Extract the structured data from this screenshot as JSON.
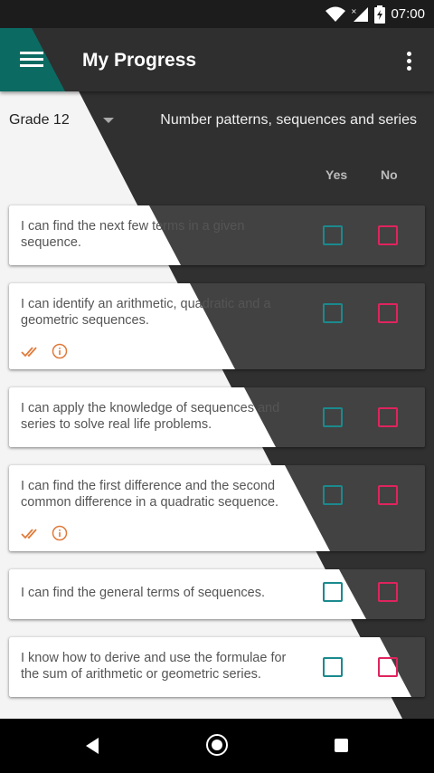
{
  "status": {
    "time": "07:00"
  },
  "app_bar": {
    "title": "My Progress"
  },
  "filters": {
    "grade": "Grade 12",
    "topic": "Number patterns, sequences and series"
  },
  "columns": {
    "yes": "Yes",
    "no": "No"
  },
  "items": [
    {
      "text": "I can find the next few terms in a given sequence.",
      "has_actions": false
    },
    {
      "text": "I can identify an arithmetic, quadratic and a geometric sequences.",
      "has_actions": true
    },
    {
      "text": "I can apply the knowledge of sequences and series to solve real life problems.",
      "has_actions": false
    },
    {
      "text": "I can find the first difference and the second common difference in a quadratic sequence.",
      "has_actions": true
    },
    {
      "text": "I can find the general terms of sequences.",
      "has_actions": false
    },
    {
      "text": "I know how to derive and use the formulae for the sum of arithmetic or geometric series.",
      "has_actions": false
    }
  ],
  "colors": {
    "accent_teal": "#1a8a8e",
    "accent_pink": "#e0245e",
    "accent_orange": "#e07a3a",
    "appbar_teal": "#0b6b63"
  },
  "icons": {
    "done_all": "double-check-icon",
    "info": "info-icon"
  }
}
